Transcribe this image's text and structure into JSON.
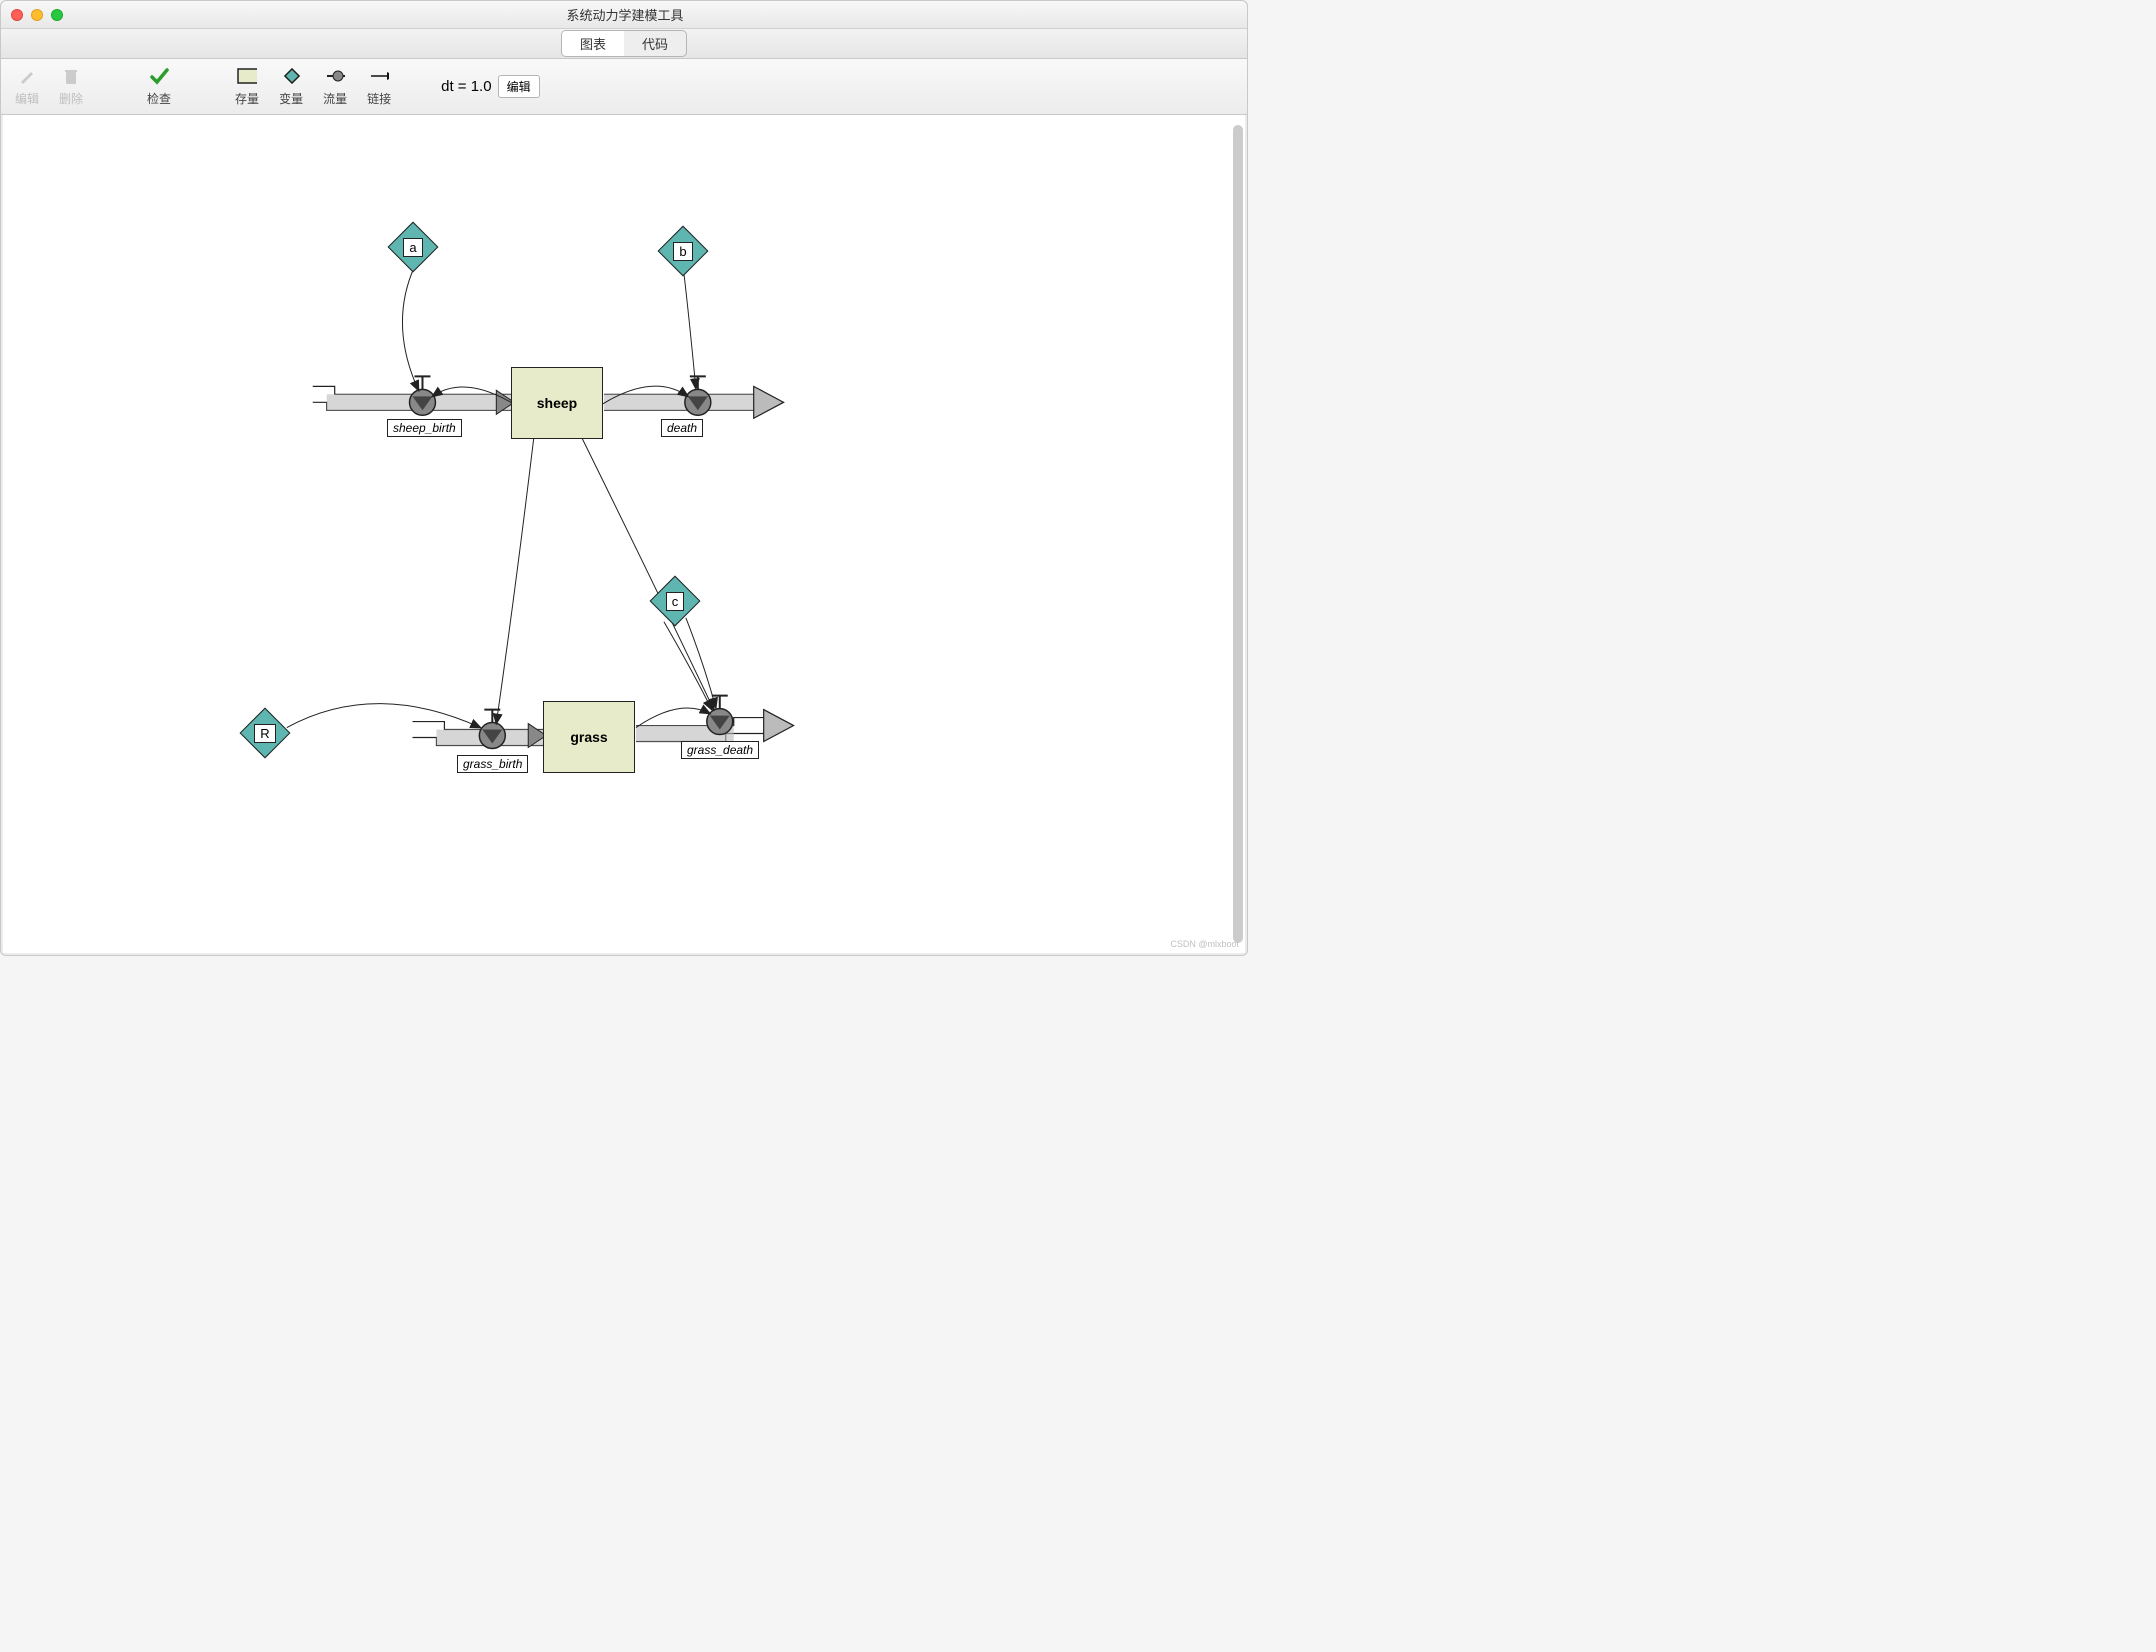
{
  "window": {
    "title": "系统动力学建模工具"
  },
  "tabs": {
    "diagram": "图表",
    "code": "代码",
    "active": "diagram"
  },
  "toolbar": {
    "edit": "编辑",
    "delete": "删除",
    "check": "检查",
    "stock": "存量",
    "variable": "变量",
    "flow": "流量",
    "link": "链接"
  },
  "dt": {
    "label": "dt = 1.0",
    "edit_button": "编辑"
  },
  "variables": {
    "a": "a",
    "b": "b",
    "c": "c",
    "R": "R"
  },
  "stocks": {
    "sheep": "sheep",
    "grass": "grass"
  },
  "flows": {
    "sheep_birth": "sheep_birth",
    "death": "death",
    "grass_birth": "grass_birth",
    "grass_death": "grass_death"
  },
  "watermark": "CSDN @mlxboot"
}
